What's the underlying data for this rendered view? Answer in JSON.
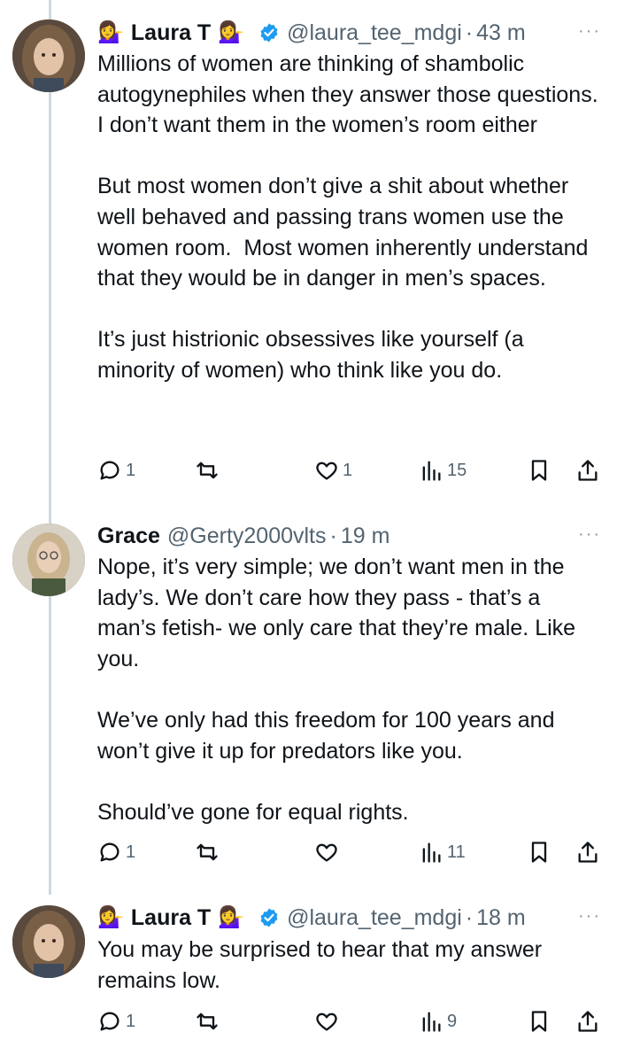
{
  "tweets": [
    {
      "author": "Laura T",
      "emoji": "💁‍♀️",
      "handle": "@laura_tee_mdgi",
      "time": "43 m",
      "verified": true,
      "text": "Millions of women are thinking of shambolic autogynephiles when they answer those questions.   I don’t want them in the women’s room either\n\nBut most women don’t give a shit about whether well behaved and passing trans women use the women room.  Most women inherently understand that they would be in danger in men’s spaces.\n\nIt’s just histrionic obsessives like yourself (a minority of women) who think like you do.",
      "replies": "1",
      "retweets": "",
      "likes": "1",
      "views": "15"
    },
    {
      "author": "Grace",
      "handle": "@Gerty2000vlts",
      "time": "19 m",
      "verified": false,
      "text": "Nope, it’s very simple; we don’t want men in the lady’s. We don’t care how they pass - that’s a man’s fetish- we only care that they’re male. Like you.\n\nWe’ve only had this freedom for 100 years and won’t give it up for predators like you.\n\nShould’ve gone for equal rights.",
      "replies": "1",
      "retweets": "",
      "likes": "",
      "views": "11"
    },
    {
      "author": "Laura T",
      "emoji": "💁‍♀️",
      "handle": "@laura_tee_mdgi",
      "time": "18 m",
      "verified": true,
      "text": "You may be surprised to hear that my answer remains low.",
      "replies": "1",
      "retweets": "",
      "likes": "",
      "views": "9"
    }
  ],
  "separator": "·",
  "more_label": "···",
  "colors": {
    "verified": "#1d9bf0",
    "text": "#0f1419",
    "muted": "#536471",
    "thread_line": "#cfd9de"
  },
  "icons": [
    "reply-icon",
    "retweet-icon",
    "like-icon",
    "views-icon",
    "bookmark-icon",
    "share-icon",
    "verified-badge-icon",
    "more-icon"
  ]
}
